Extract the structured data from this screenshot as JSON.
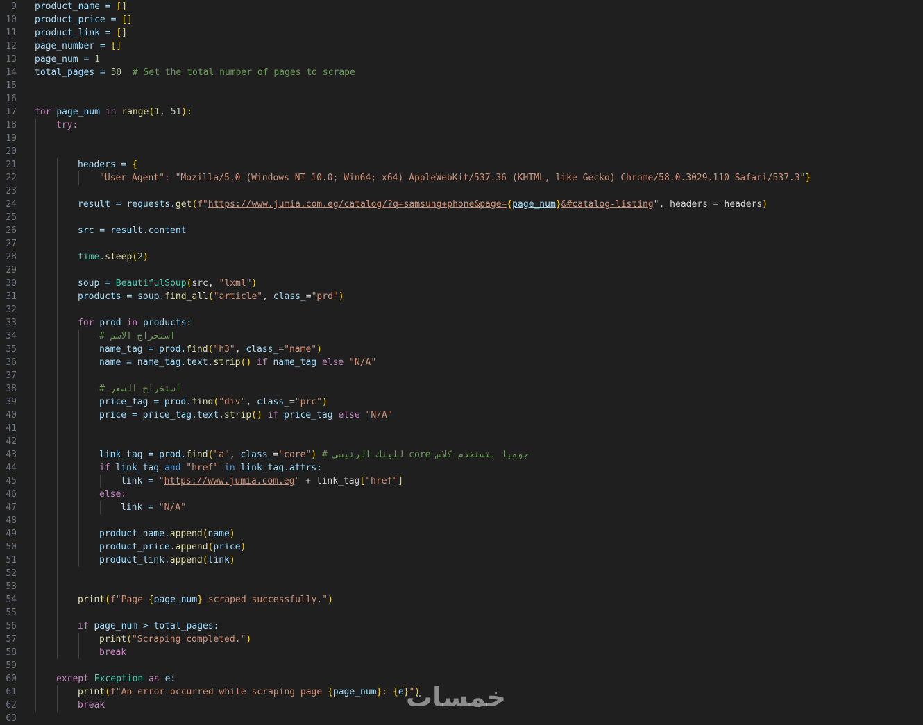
{
  "editor": {
    "lines": [
      {
        "n": "9",
        "parts": [
          [
            "product_name = ",
            "var"
          ],
          [
            "[]",
            "brk"
          ]
        ]
      },
      {
        "n": "10",
        "parts": [
          [
            "product_price = ",
            "var"
          ],
          [
            "[]",
            "brk"
          ]
        ]
      },
      {
        "n": "11",
        "parts": [
          [
            "product_link = ",
            "var"
          ],
          [
            "[]",
            "brk"
          ]
        ]
      },
      {
        "n": "12",
        "parts": [
          [
            "page_number = ",
            "var"
          ],
          [
            "[]",
            "brk"
          ]
        ]
      },
      {
        "n": "13",
        "parts": [
          [
            "page_num = ",
            "var"
          ],
          [
            "1",
            "num"
          ]
        ]
      },
      {
        "n": "14",
        "parts": [
          [
            "total_pages = ",
            "var"
          ],
          [
            "50",
            "num"
          ],
          [
            "  # Set the total number of pages to scrape",
            "cm"
          ]
        ]
      },
      {
        "n": "15",
        "parts": []
      },
      {
        "n": "16",
        "parts": []
      },
      {
        "n": "17",
        "parts": [
          [
            "for ",
            "ctl"
          ],
          [
            "page_num ",
            "var"
          ],
          [
            "in ",
            "ctl"
          ],
          [
            "range",
            "fn"
          ],
          [
            "(",
            "brk"
          ],
          [
            "1",
            "num"
          ],
          [
            ", ",
            ""
          ],
          [
            "51",
            "num"
          ],
          [
            "):",
            "brk"
          ]
        ]
      },
      {
        "n": "18",
        "indent": 1,
        "parts": [
          [
            "try:",
            "ctl"
          ]
        ]
      },
      {
        "n": "19",
        "parts": []
      },
      {
        "n": "20",
        "parts": []
      },
      {
        "n": "21",
        "indent": 2,
        "parts": [
          [
            "headers = ",
            "var"
          ],
          [
            "{",
            "brk"
          ]
        ]
      },
      {
        "n": "22",
        "indent": 3,
        "parts": [
          [
            "\"User-Agent\": \"Mozilla/5.0 (Windows NT 10.0; Win64; x64) AppleWebKit/537.36 (KHTML, like Gecko) Chrome/58.0.3029.110 Safari/537.3\"",
            "str"
          ],
          [
            "}",
            "brk"
          ]
        ]
      },
      {
        "n": "23",
        "parts": []
      },
      {
        "n": "24",
        "indent": 2,
        "parts": [
          [
            "result = ",
            "var"
          ],
          [
            "requests.",
            "var"
          ],
          [
            "get",
            "fn"
          ],
          [
            "(",
            "brk"
          ],
          [
            "f\"",
            "str"
          ],
          [
            "https://www.jumia.com.eg/catalog/?q=samsung+phone&page=",
            "str ul"
          ],
          [
            "{",
            "brk"
          ],
          [
            "page_num",
            "var ul"
          ],
          [
            "}",
            "brk"
          ],
          [
            "&#catalog-listing",
            "str ul"
          ],
          [
            "\"",
            ""
          ],
          [
            ", headers = headers",
            ""
          ],
          [
            ")",
            "brk"
          ]
        ]
      },
      {
        "n": "25",
        "parts": []
      },
      {
        "n": "26",
        "indent": 2,
        "parts": [
          [
            "src = result.content",
            "var"
          ]
        ]
      },
      {
        "n": "27",
        "parts": []
      },
      {
        "n": "28",
        "indent": 2,
        "parts": [
          [
            "time.",
            "cls"
          ],
          [
            "sleep",
            "fn"
          ],
          [
            "(",
            "brk"
          ],
          [
            "2",
            "num"
          ],
          [
            ")",
            "brk"
          ]
        ]
      },
      {
        "n": "29",
        "parts": []
      },
      {
        "n": "30",
        "indent": 2,
        "parts": [
          [
            "soup = ",
            "var"
          ],
          [
            "BeautifulSoup",
            "cls"
          ],
          [
            "(",
            "brk"
          ],
          [
            "src, ",
            ""
          ],
          [
            "\"lxml\"",
            "str"
          ],
          [
            ")",
            "brk"
          ]
        ]
      },
      {
        "n": "31",
        "indent": 2,
        "parts": [
          [
            "products = soup.",
            "var"
          ],
          [
            "find_all",
            "fn"
          ],
          [
            "(",
            "brk"
          ],
          [
            "\"article\"",
            "str"
          ],
          [
            ", ",
            ""
          ],
          [
            "class_",
            "var"
          ],
          [
            "=",
            ""
          ],
          [
            "\"prd\"",
            "str"
          ],
          [
            ")",
            "brk"
          ]
        ]
      },
      {
        "n": "32",
        "parts": []
      },
      {
        "n": "33",
        "indent": 2,
        "parts": [
          [
            "for ",
            "ctl"
          ],
          [
            "prod ",
            "var"
          ],
          [
            "in ",
            "ctl"
          ],
          [
            "products:",
            "var"
          ]
        ]
      },
      {
        "n": "34",
        "indent": 3,
        "parts": [
          [
            "# استخراج الاسم",
            "cm"
          ]
        ]
      },
      {
        "n": "35",
        "indent": 3,
        "parts": [
          [
            "name_tag = prod.",
            "var"
          ],
          [
            "find",
            "fn"
          ],
          [
            "(",
            "brk"
          ],
          [
            "\"h3\"",
            "str"
          ],
          [
            ", ",
            ""
          ],
          [
            "class_",
            "var"
          ],
          [
            "=",
            ""
          ],
          [
            "\"name\"",
            "str"
          ],
          [
            ")",
            "brk"
          ]
        ]
      },
      {
        "n": "36",
        "indent": 3,
        "parts": [
          [
            "name = name_tag.text.",
            "var"
          ],
          [
            "strip",
            "fn"
          ],
          [
            "() ",
            "brk"
          ],
          [
            "if ",
            "ctl"
          ],
          [
            "name_tag ",
            "var"
          ],
          [
            "else ",
            "ctl"
          ],
          [
            "\"N/A\"",
            "str"
          ]
        ]
      },
      {
        "n": "37",
        "parts": []
      },
      {
        "n": "38",
        "indent": 3,
        "parts": [
          [
            "# استخراج السعر",
            "cm"
          ]
        ]
      },
      {
        "n": "39",
        "indent": 3,
        "parts": [
          [
            "price_tag = prod.",
            "var"
          ],
          [
            "find",
            "fn"
          ],
          [
            "(",
            "brk"
          ],
          [
            "\"div\"",
            "str"
          ],
          [
            ", ",
            ""
          ],
          [
            "class_",
            "var"
          ],
          [
            "=",
            ""
          ],
          [
            "\"prc\"",
            "str"
          ],
          [
            ")",
            "brk"
          ]
        ]
      },
      {
        "n": "40",
        "indent": 3,
        "parts": [
          [
            "price = price_tag.text.",
            "var"
          ],
          [
            "strip",
            "fn"
          ],
          [
            "() ",
            "brk"
          ],
          [
            "if ",
            "ctl"
          ],
          [
            "price_tag ",
            "var"
          ],
          [
            "else ",
            "ctl"
          ],
          [
            "\"N/A\"",
            "str"
          ]
        ]
      },
      {
        "n": "41",
        "parts": []
      },
      {
        "n": "42",
        "parts": []
      },
      {
        "n": "43",
        "indent": 3,
        "parts": [
          [
            "link_tag = prod.",
            "var"
          ],
          [
            "find",
            "fn"
          ],
          [
            "(",
            "brk"
          ],
          [
            "\"a\"",
            "str"
          ],
          [
            ", ",
            ""
          ],
          [
            "class_",
            "var"
          ],
          [
            "=",
            ""
          ],
          [
            "\"core\"",
            "str"
          ],
          [
            ")",
            "brk"
          ],
          [
            " # للينك الرئيسي core جوميا بتستخدم كلاس",
            "cm"
          ]
        ]
      },
      {
        "n": "44",
        "indent": 3,
        "parts": [
          [
            "if ",
            "ctl"
          ],
          [
            "link_tag ",
            "var"
          ],
          [
            "and ",
            "kw"
          ],
          [
            "\"href\" ",
            "str"
          ],
          [
            "in ",
            "kw"
          ],
          [
            "link_tag.attrs:",
            "var"
          ]
        ]
      },
      {
        "n": "45",
        "indent": 4,
        "parts": [
          [
            "link = ",
            "var"
          ],
          [
            "\"",
            "str"
          ],
          [
            "https://www.jumia.com.eg",
            "str ul"
          ],
          [
            "\"",
            "str"
          ],
          [
            " + link_tag",
            ""
          ],
          [
            "[",
            "brk"
          ],
          [
            "\"href\"",
            "str"
          ],
          [
            "]",
            "brk"
          ]
        ]
      },
      {
        "n": "46",
        "indent": 3,
        "parts": [
          [
            "else:",
            "ctl"
          ]
        ]
      },
      {
        "n": "47",
        "indent": 4,
        "parts": [
          [
            "link = ",
            "var"
          ],
          [
            "\"N/A\"",
            "str"
          ]
        ]
      },
      {
        "n": "48",
        "parts": []
      },
      {
        "n": "49",
        "indent": 3,
        "parts": [
          [
            "product_name.",
            "var"
          ],
          [
            "append",
            "fn"
          ],
          [
            "(",
            "brk"
          ],
          [
            "name",
            "var"
          ],
          [
            ")",
            "brk"
          ]
        ]
      },
      {
        "n": "50",
        "indent": 3,
        "parts": [
          [
            "product_price.",
            "var"
          ],
          [
            "append",
            "fn"
          ],
          [
            "(",
            "brk"
          ],
          [
            "price",
            "var"
          ],
          [
            ")",
            "brk"
          ]
        ]
      },
      {
        "n": "51",
        "indent": 3,
        "parts": [
          [
            "product_link.",
            "var"
          ],
          [
            "append",
            "fn"
          ],
          [
            "(",
            "brk"
          ],
          [
            "link",
            "var"
          ],
          [
            ")",
            "brk"
          ]
        ]
      },
      {
        "n": "52",
        "parts": []
      },
      {
        "n": "53",
        "parts": []
      },
      {
        "n": "54",
        "indent": 2,
        "parts": [
          [
            "print",
            "fn"
          ],
          [
            "(",
            "brk"
          ],
          [
            "f\"Page ",
            "str"
          ],
          [
            "{",
            "brk"
          ],
          [
            "page_num",
            "var"
          ],
          [
            "}",
            "brk"
          ],
          [
            " scraped successfully.\"",
            "str"
          ],
          [
            ")",
            "brk"
          ]
        ]
      },
      {
        "n": "55",
        "parts": []
      },
      {
        "n": "56",
        "indent": 2,
        "parts": [
          [
            "if ",
            "ctl"
          ],
          [
            "page_num > total_pages:",
            "var"
          ]
        ]
      },
      {
        "n": "57",
        "indent": 3,
        "parts": [
          [
            "print",
            "fn"
          ],
          [
            "(",
            "brk"
          ],
          [
            "\"Scraping completed.\"",
            "str"
          ],
          [
            ")",
            "brk"
          ]
        ]
      },
      {
        "n": "58",
        "indent": 3,
        "parts": [
          [
            "break",
            "ctl"
          ]
        ]
      },
      {
        "n": "59",
        "parts": []
      },
      {
        "n": "60",
        "indent": 1,
        "parts": [
          [
            "except ",
            "ctl"
          ],
          [
            "Exception ",
            "cls"
          ],
          [
            "as ",
            "ctl"
          ],
          [
            "e:",
            "var"
          ]
        ]
      },
      {
        "n": "61",
        "indent": 2,
        "parts": [
          [
            "print",
            "fn"
          ],
          [
            "(",
            "brk"
          ],
          [
            "f\"An error occurred while scraping page ",
            "str"
          ],
          [
            "{",
            "brk"
          ],
          [
            "page_num",
            "var"
          ],
          [
            "}",
            "brk"
          ],
          [
            ": ",
            "str"
          ],
          [
            "{",
            "brk"
          ],
          [
            "e",
            "var"
          ],
          [
            "}",
            "brk"
          ],
          [
            "\"",
            "str"
          ],
          [
            ")",
            "brk"
          ]
        ]
      },
      {
        "n": "62",
        "indent": 2,
        "parts": [
          [
            "break",
            "ctl"
          ]
        ]
      },
      {
        "n": "63",
        "parts": []
      }
    ]
  },
  "watermark": "خمسات"
}
